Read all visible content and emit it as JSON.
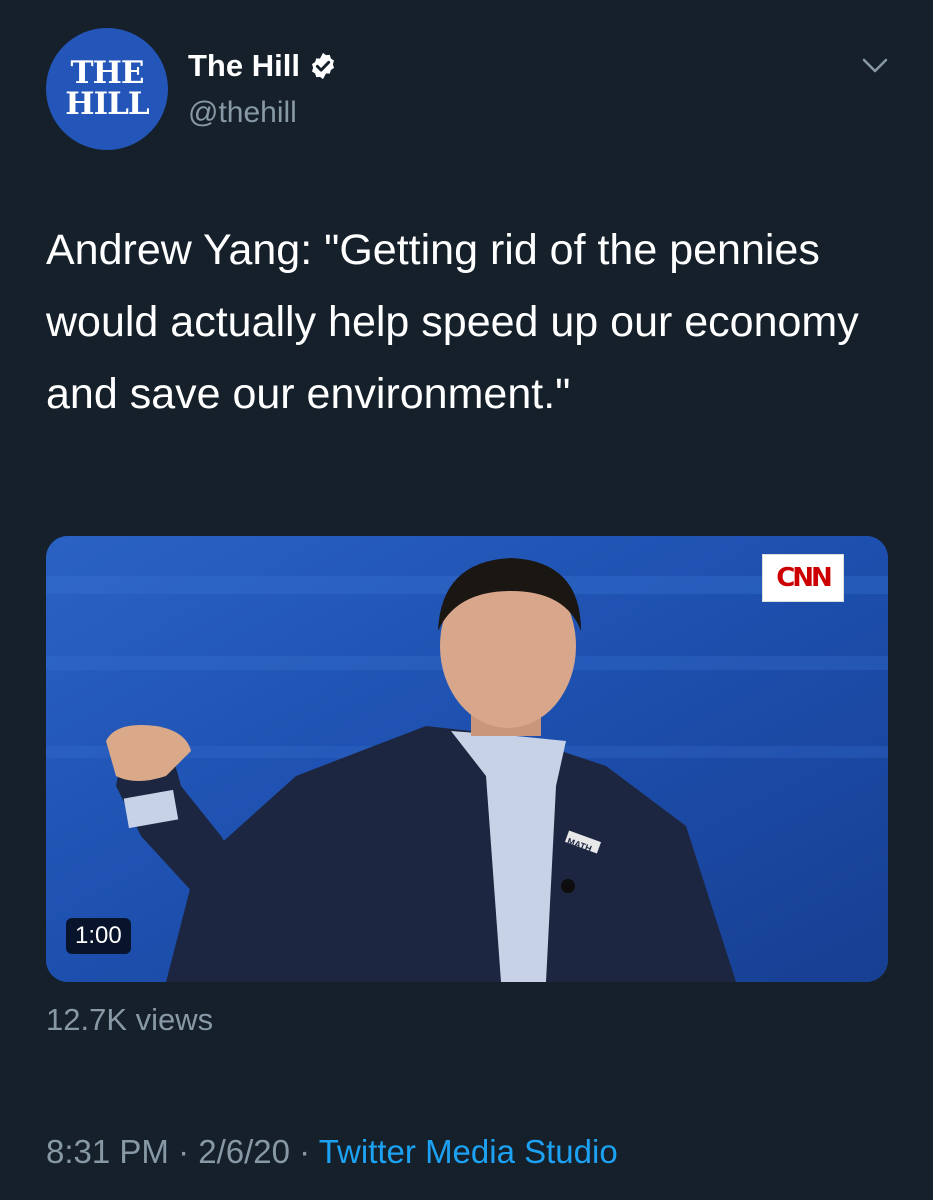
{
  "account": {
    "avatar_line1": "THE",
    "avatar_line2": "HILL",
    "display_name": "The Hill",
    "handle": "@thehill",
    "verified": true
  },
  "tweet": {
    "text": "Andrew Yang: \"Getting rid of the pennies would actually help speed up our economy and save our environment.\""
  },
  "media": {
    "network_logo": "CNN",
    "lapel_text": "MATH",
    "duration": "1:00",
    "views": "12.7K views"
  },
  "meta": {
    "time": "8:31 PM",
    "separator1": " · ",
    "date": "2/6/20",
    "separator2": " · ",
    "source": "Twitter Media Studio"
  },
  "icons": {
    "verified": "verified-badge-icon",
    "menu": "chevron-down-icon"
  },
  "colors": {
    "background": "#15202b",
    "secondary_text": "#8899a6",
    "link": "#1da1f2",
    "avatar": "#2356b8"
  }
}
